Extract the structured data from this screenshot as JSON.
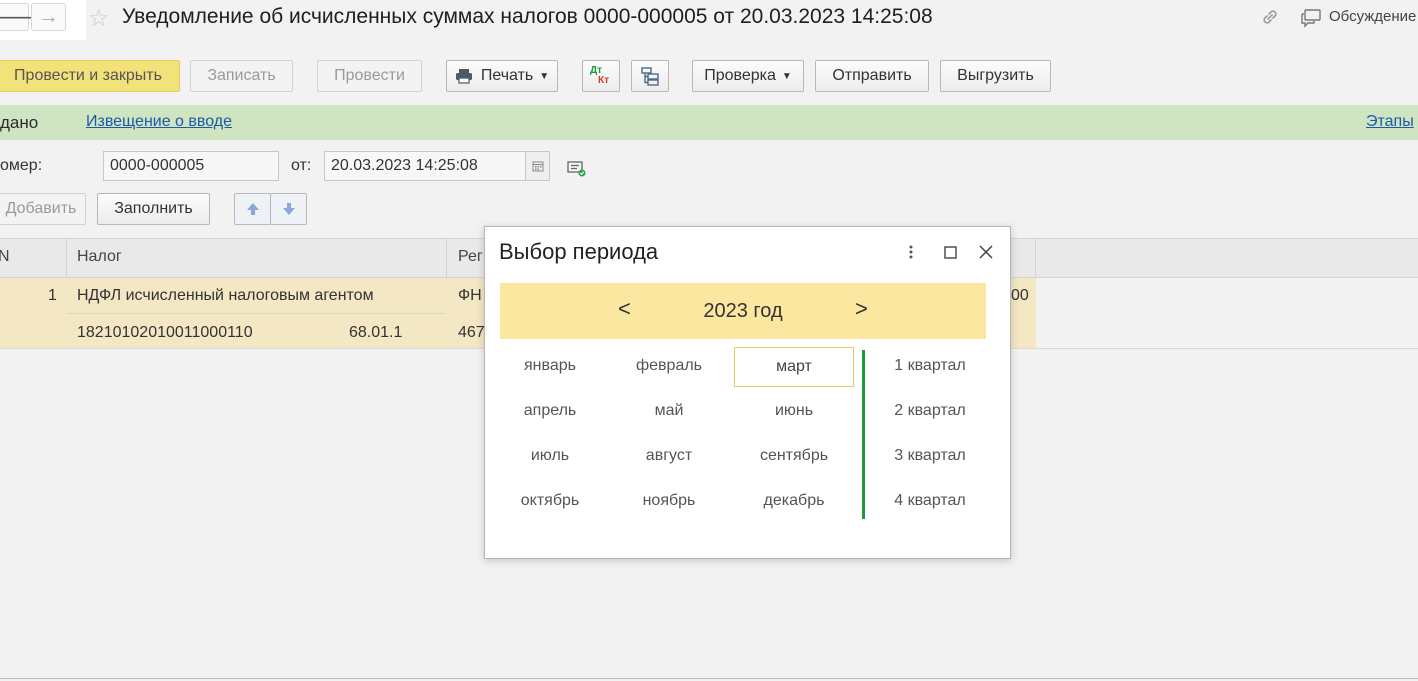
{
  "header": {
    "title": "Уведомление об исчисленных суммах налогов 0000-000005 от 20.03.2023 14:25:08",
    "back_glyph": "🡐",
    "forward_glyph": "→",
    "star_glyph": "☆",
    "discussions": "Обсуждение"
  },
  "toolbar": {
    "post_close": "Провести и закрыть",
    "save": "Записать",
    "post": "Провести",
    "print": "Печать",
    "check": "Проверка",
    "send": "Отправить",
    "export": "Выгрузить",
    "dt_label": "Дт",
    "kt_label": "Кт"
  },
  "status": {
    "state": "дано",
    "notice_link": "Извещение о вводе",
    "stages_link": "Этапы"
  },
  "form": {
    "number_label": "омер:",
    "number_value": "0000-000005",
    "date_label": "от:",
    "date_value": "20.03.2023 14:25:08",
    "add_button": "Добавить",
    "fill_button": "Заполнить"
  },
  "table": {
    "columns": [
      "N",
      "Налог",
      "Рег"
    ],
    "rows": [
      {
        "n": "1",
        "tax": "НДФЛ исчисленный налоговым агентом",
        "reg": "ФН",
        "kbk": "18210102010011000110",
        "account": "68.01.1",
        "reg2": "467",
        "right_value": "00"
      }
    ]
  },
  "period_dialog": {
    "title": "Выбор периода",
    "prev": "<",
    "next": ">",
    "year": "2023 год",
    "months": [
      "январь",
      "февраль",
      "март",
      "апрель",
      "май",
      "июнь",
      "июль",
      "август",
      "сентябрь",
      "октябрь",
      "ноябрь",
      "декабрь"
    ],
    "selected_month": "март",
    "quarters": [
      "1 квартал",
      "2 квартал",
      "3 квартал",
      "4 квартал"
    ],
    "colors": {
      "year_band": "#fbe79f",
      "separator": "#1e9a3c",
      "selected_border": "#e9c96b"
    }
  }
}
